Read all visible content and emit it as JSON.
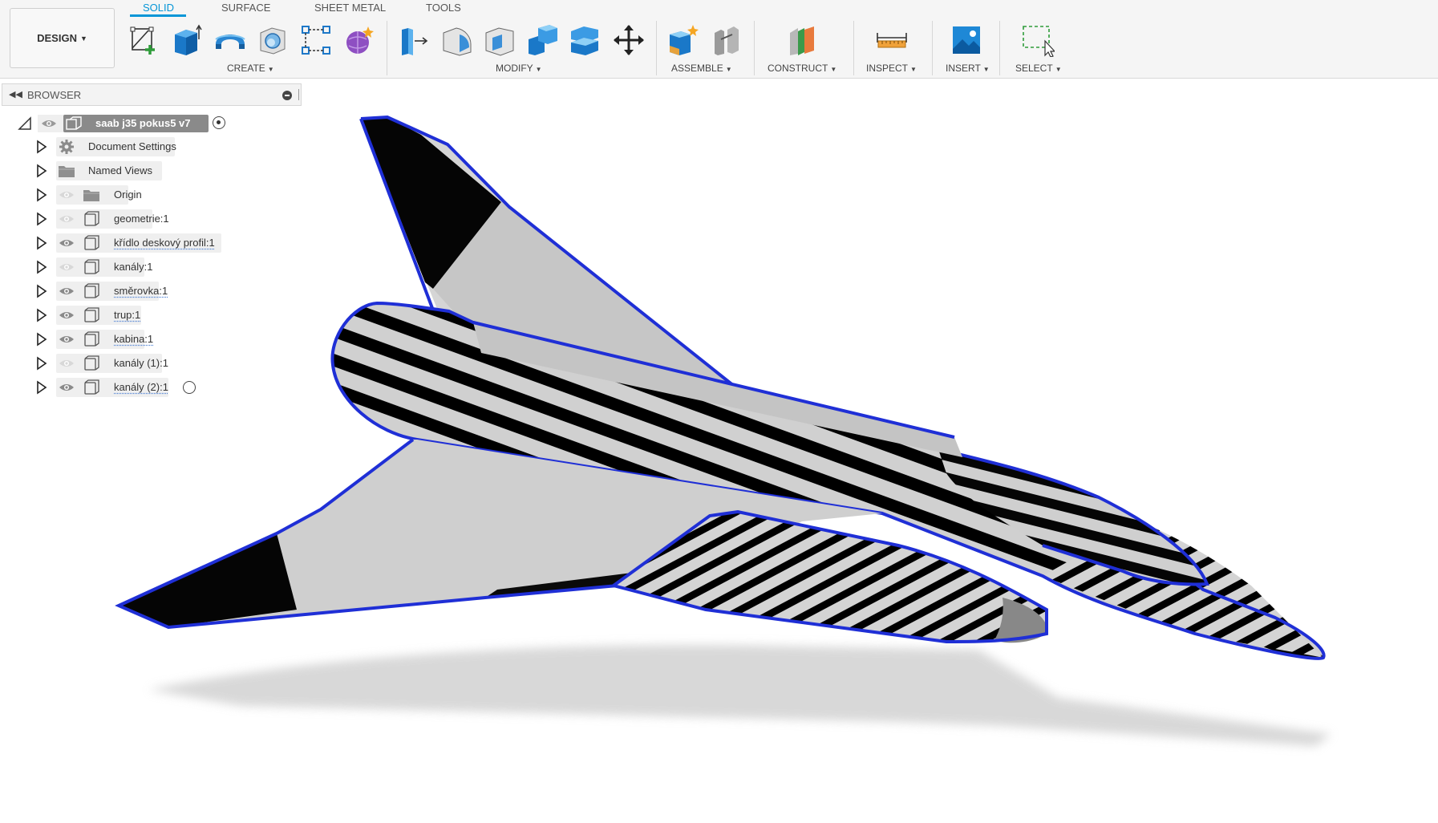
{
  "workspace": {
    "label": "DESIGN"
  },
  "tabs": [
    {
      "label": "SOLID",
      "active": true
    },
    {
      "label": "SURFACE",
      "active": false
    },
    {
      "label": "SHEET METAL",
      "active": false
    },
    {
      "label": "TOOLS",
      "active": false
    }
  ],
  "tool_groups": [
    {
      "label": "CREATE",
      "tools": [
        "create-sketch-icon",
        "extrude-icon",
        "revolve-icon",
        "hole-icon",
        "pattern-icon",
        "form-icon"
      ]
    },
    {
      "label": "MODIFY",
      "tools": [
        "press-pull-icon",
        "fillet-icon",
        "shell-icon",
        "combine-icon",
        "split-body-icon",
        "move-icon"
      ]
    },
    {
      "label": "ASSEMBLE",
      "tools": [
        "new-component-icon",
        "joint-icon"
      ]
    },
    {
      "label": "CONSTRUCT",
      "tools": [
        "offset-plane-icon"
      ]
    },
    {
      "label": "INSPECT",
      "tools": [
        "measure-icon"
      ]
    },
    {
      "label": "INSERT",
      "tools": [
        "insert-image-icon"
      ]
    },
    {
      "label": "SELECT",
      "tools": [
        "window-select-icon"
      ]
    }
  ],
  "browser": {
    "title": "BROWSER",
    "root": {
      "label": "saab j35 pokus5 v7"
    },
    "items": [
      {
        "label": "Document Settings",
        "icon": "gear-icon",
        "visible": null,
        "linked": false
      },
      {
        "label": "Named Views",
        "icon": "folder-icon",
        "visible": null,
        "linked": false
      },
      {
        "label": "Origin",
        "icon": "folder-icon",
        "visible": false,
        "linked": false
      },
      {
        "label": "geometrie:1",
        "icon": "component-icon",
        "visible": false,
        "linked": false
      },
      {
        "label": "křídlo deskový profil:1",
        "icon": "component-icon",
        "visible": true,
        "linked": true
      },
      {
        "label": "kanály:1",
        "icon": "component-icon",
        "visible": false,
        "linked": false
      },
      {
        "label": "směrovka:1",
        "icon": "component-icon",
        "visible": true,
        "linked": true
      },
      {
        "label": "trup:1",
        "icon": "component-icon",
        "visible": true,
        "linked": true
      },
      {
        "label": "kabina:1",
        "icon": "component-icon",
        "visible": true,
        "linked": true
      },
      {
        "label": "kanály (1):1",
        "icon": "component-icon",
        "visible": false,
        "linked": false
      },
      {
        "label": "kanály (2):1",
        "icon": "component-icon",
        "visible": true,
        "linked": true
      }
    ]
  },
  "colors": {
    "accent": "#0696d7",
    "selection_outline": "#1f2fd6",
    "zebra_dark": "#000000",
    "zebra_light": "#d0d0d0"
  }
}
